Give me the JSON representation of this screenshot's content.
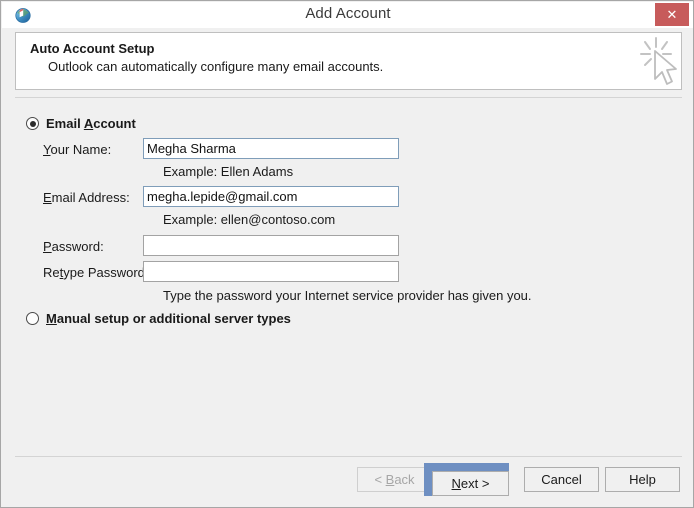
{
  "window": {
    "title": "Add Account",
    "app_icon": "outlook-globe-icon",
    "close_label": "✕"
  },
  "header": {
    "title": "Auto Account Setup",
    "subtitle": "Outlook can automatically configure many email accounts.",
    "decoration_icon": "mouse-cursor-sparkle-icon"
  },
  "form": {
    "email_account_radio": {
      "label_pre": "Email ",
      "label_accel": "A",
      "label_post": "ccount",
      "checked": true
    },
    "manual_setup_radio": {
      "label_pre": "",
      "label_accel": "M",
      "label_post": "anual setup or additional server types",
      "checked": false
    },
    "fields": [
      {
        "label_pre": "",
        "label_accel": "Y",
        "label_post": "our Name:",
        "value": "Megha Sharma",
        "placeholder": "",
        "type": "text",
        "border": "blue"
      },
      {
        "label_pre": "",
        "label_accel": "E",
        "label_post": "mail Address:",
        "value": "megha.lepide@gmail.com",
        "placeholder": "",
        "type": "text",
        "border": "blue"
      },
      {
        "label_pre": "",
        "label_accel": "P",
        "label_post": "assword:",
        "value": "",
        "placeholder": "",
        "type": "password",
        "border": "gray"
      },
      {
        "label_pre": "Re",
        "label_accel": "t",
        "label_post": "ype Password:",
        "value": "",
        "placeholder": "",
        "type": "password",
        "border": "gray"
      }
    ],
    "hints": {
      "name_example": "Example: Ellen Adams",
      "email_example": "Example: ellen@contoso.com",
      "password_help": "Type the password your Internet service provider has given you."
    }
  },
  "footer": {
    "back": {
      "pre": "< ",
      "accel": "B",
      "post": "ack",
      "disabled": true
    },
    "next": {
      "pre": "",
      "accel": "N",
      "post": "ext >",
      "focused": true
    },
    "cancel": {
      "pre": "Cancel",
      "accel": "",
      "post": ""
    },
    "help": {
      "pre": "Help",
      "accel": "",
      "post": ""
    }
  },
  "colors": {
    "close_red": "#c75b5b",
    "focus_blue": "#6e8fc2",
    "input_blue_border": "#7f9db9",
    "dialog_bg": "#f0f0f0"
  }
}
